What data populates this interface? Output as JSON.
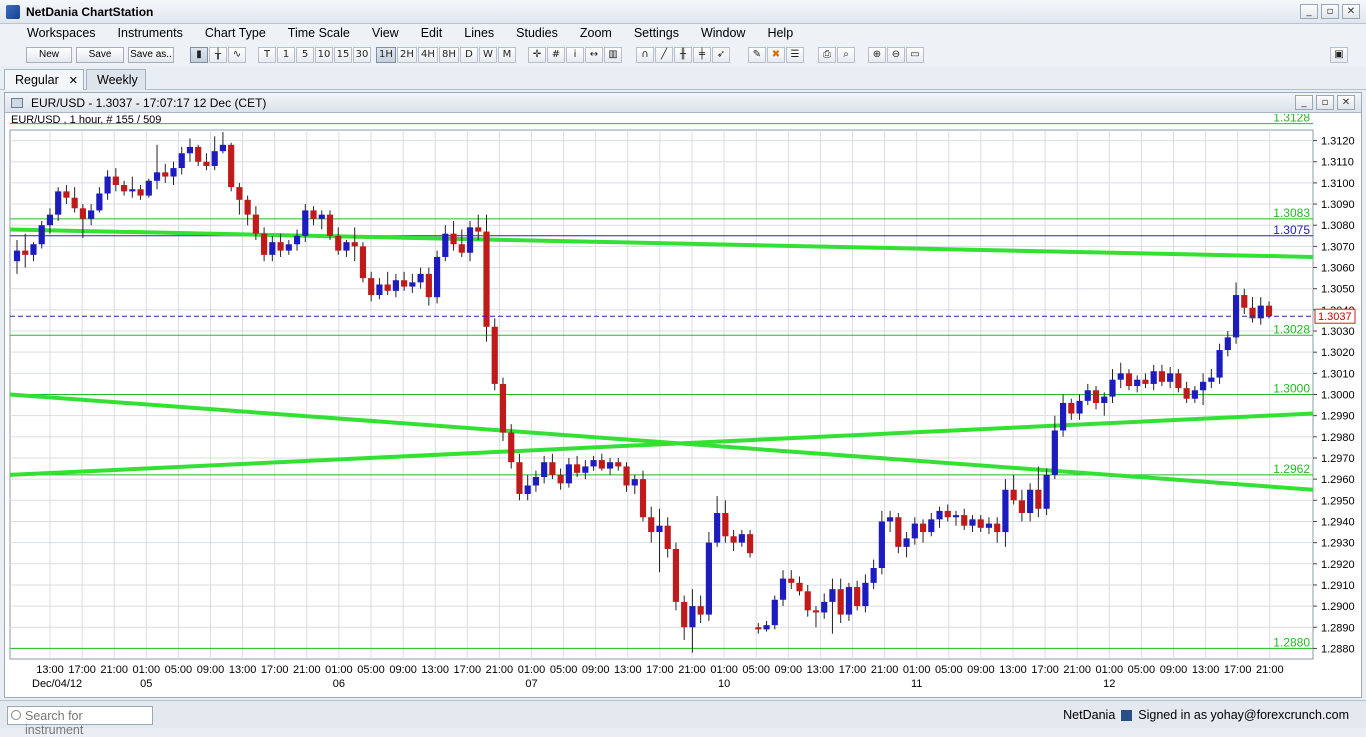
{
  "app": {
    "title": "NetDania ChartStation",
    "controls": {
      "minimize": "_",
      "restore": "▫",
      "close": "✕"
    }
  },
  "menu": [
    "Workspaces",
    "Instruments",
    "Chart Type",
    "Time Scale",
    "View",
    "Edit",
    "Lines",
    "Studies",
    "Zoom",
    "Settings",
    "Window",
    "Help"
  ],
  "toolbar": {
    "new_label": "New",
    "save_label": "Save",
    "save_as_label": "Save as..",
    "periods": [
      "T",
      "1",
      "5",
      "10",
      "15",
      "30",
      "1H",
      "2H",
      "4H",
      "8H",
      "D",
      "W",
      "M"
    ],
    "selected_period": "1H"
  },
  "tabs": [
    {
      "label": "Regular",
      "close": "✕",
      "active": true
    },
    {
      "label": "Weekly",
      "active": false
    }
  ],
  "chart_window": {
    "title": "EUR/USD - 1.3037 - 17:07:17  12 Dec (CET)",
    "subtitle": "EUR/USD , 1 hour, # 155 / 509"
  },
  "chart_data": {
    "type": "candlestick",
    "instrument": "EUR/USD",
    "interval": "1 hour",
    "current_price": "1.3037",
    "ylim": [
      1.2875,
      1.3125
    ],
    "y_ticks": [
      "1.3120",
      "1.3110",
      "1.3100",
      "1.3090",
      "1.3080",
      "1.3070",
      "1.3060",
      "1.3050",
      "1.3040",
      "1.3030",
      "1.3020",
      "1.3010",
      "1.3000",
      "1.2990",
      "1.2980",
      "1.2970",
      "1.2960",
      "1.2950",
      "1.2940",
      "1.2930",
      "1.2920",
      "1.2910",
      "1.2900",
      "1.2890",
      "1.2880"
    ],
    "x_time_labels": [
      "13:00",
      "17:00",
      "21:00",
      "01:00",
      "05:00",
      "09:00",
      "13:00",
      "17:00",
      "21:00",
      "01:00",
      "05:00",
      "09:00",
      "13:00",
      "17:00",
      "21:00",
      "01:00",
      "05:00",
      "09:00",
      "13:00",
      "17:00",
      "21:00",
      "01:00",
      "05:00",
      "09:00",
      "13:00",
      "17:00",
      "21:00",
      "01:00",
      "05:00",
      "09:00",
      "13:00",
      "17:00",
      "21:00",
      "01:00",
      "05:00",
      "09:00",
      "13:00",
      "17:00",
      "21:00"
    ],
    "x_date_labels": [
      {
        "label": "Dec/04/12",
        "index": 0
      },
      {
        "label": "05",
        "index": 3
      },
      {
        "label": "06",
        "index": 9
      },
      {
        "label": "07",
        "index": 15
      },
      {
        "label": "10",
        "index": 21
      },
      {
        "label": "11",
        "index": 27
      },
      {
        "label": "12",
        "index": 33
      }
    ],
    "horizontal_levels": [
      {
        "value": 1.3128,
        "label": "1.3128",
        "color": "#22bb22"
      },
      {
        "value": 1.3083,
        "label": "1.3083",
        "color": "#22bb22"
      },
      {
        "value": 1.3075,
        "label": "1.3075",
        "color": "#2222bb"
      },
      {
        "value": 1.3028,
        "label": "1.3028",
        "color": "#22bb22"
      },
      {
        "value": 1.3,
        "label": "1.3000",
        "color": "#22bb22"
      },
      {
        "value": 1.2962,
        "label": "1.2962",
        "color": "#22bb22"
      },
      {
        "value": 1.288,
        "label": "1.2880",
        "color": "#22bb22"
      }
    ],
    "trend_lines": [
      {
        "from": [
          0,
          1.3078
        ],
        "to": [
          1,
          1.3065
        ]
      },
      {
        "from": [
          0,
          1.3
        ],
        "to": [
          1,
          1.2955
        ]
      },
      {
        "from": [
          0,
          1.2962
        ],
        "to": [
          1,
          1.2991
        ]
      }
    ],
    "candles": [
      [
        1.3063,
        1.3073,
        1.3057,
        1.3068
      ],
      [
        1.3068,
        1.3076,
        1.306,
        1.3066
      ],
      [
        1.3066,
        1.3072,
        1.3063,
        1.3071
      ],
      [
        1.3071,
        1.3082,
        1.3069,
        1.308
      ],
      [
        1.308,
        1.3088,
        1.3076,
        1.3085
      ],
      [
        1.3085,
        1.3098,
        1.3082,
        1.3096
      ],
      [
        1.3096,
        1.3099,
        1.309,
        1.3093
      ],
      [
        1.3093,
        1.3098,
        1.3086,
        1.3088
      ],
      [
        1.3088,
        1.309,
        1.3074,
        1.3083
      ],
      [
        1.3083,
        1.309,
        1.308,
        1.3087
      ],
      [
        1.3087,
        1.3098,
        1.3086,
        1.3095
      ],
      [
        1.3095,
        1.3106,
        1.3092,
        1.3103
      ],
      [
        1.3103,
        1.3107,
        1.3096,
        1.3099
      ],
      [
        1.3099,
        1.3101,
        1.3094,
        1.3096
      ],
      [
        1.3096,
        1.3103,
        1.3093,
        1.3097
      ],
      [
        1.3097,
        1.3099,
        1.3092,
        1.3094
      ],
      [
        1.3094,
        1.3102,
        1.3093,
        1.3101
      ],
      [
        1.3101,
        1.3118,
        1.3097,
        1.3105
      ],
      [
        1.3105,
        1.3109,
        1.31,
        1.3103
      ],
      [
        1.3103,
        1.311,
        1.3099,
        1.3107
      ],
      [
        1.3107,
        1.3117,
        1.3104,
        1.3114
      ],
      [
        1.3114,
        1.3121,
        1.311,
        1.3117
      ],
      [
        1.3117,
        1.3118,
        1.3108,
        1.311
      ],
      [
        1.311,
        1.3114,
        1.3106,
        1.3108
      ],
      [
        1.3108,
        1.3122,
        1.3106,
        1.3115
      ],
      [
        1.3115,
        1.3124,
        1.3114,
        1.3118
      ],
      [
        1.3118,
        1.3119,
        1.3096,
        1.3098
      ],
      [
        1.3098,
        1.31,
        1.3085,
        1.3092
      ],
      [
        1.3092,
        1.3094,
        1.308,
        1.3085
      ],
      [
        1.3085,
        1.3089,
        1.3073,
        1.3076
      ],
      [
        1.3076,
        1.3079,
        1.3063,
        1.3066
      ],
      [
        1.3066,
        1.3075,
        1.3063,
        1.3072
      ],
      [
        1.3072,
        1.3076,
        1.3065,
        1.3068
      ],
      [
        1.3068,
        1.3073,
        1.3066,
        1.3071
      ],
      [
        1.3071,
        1.3078,
        1.3068,
        1.3075
      ],
      [
        1.3075,
        1.309,
        1.3072,
        1.3087
      ],
      [
        1.3087,
        1.3089,
        1.308,
        1.3083
      ],
      [
        1.3083,
        1.3087,
        1.3078,
        1.3085
      ],
      [
        1.3085,
        1.3087,
        1.3073,
        1.3075
      ],
      [
        1.3075,
        1.3079,
        1.3066,
        1.3068
      ],
      [
        1.3068,
        1.3073,
        1.3065,
        1.3072
      ],
      [
        1.3072,
        1.3079,
        1.3063,
        1.307
      ],
      [
        1.307,
        1.3072,
        1.3053,
        1.3055
      ],
      [
        1.3055,
        1.3058,
        1.3044,
        1.3047
      ],
      [
        1.3047,
        1.3055,
        1.3045,
        1.3052
      ],
      [
        1.3052,
        1.3058,
        1.3047,
        1.3049
      ],
      [
        1.3049,
        1.3057,
        1.3046,
        1.3054
      ],
      [
        1.3054,
        1.3058,
        1.3049,
        1.3051
      ],
      [
        1.3051,
        1.3057,
        1.3048,
        1.3053
      ],
      [
        1.3053,
        1.306,
        1.305,
        1.3057
      ],
      [
        1.3057,
        1.306,
        1.3042,
        1.3046
      ],
      [
        1.3046,
        1.3068,
        1.3043,
        1.3065
      ],
      [
        1.3065,
        1.308,
        1.3063,
        1.3076
      ],
      [
        1.3076,
        1.3082,
        1.3068,
        1.3071
      ],
      [
        1.3071,
        1.3078,
        1.3065,
        1.3067
      ],
      [
        1.3067,
        1.3082,
        1.3063,
        1.3079
      ],
      [
        1.3079,
        1.3085,
        1.3073,
        1.3077
      ],
      [
        1.3077,
        1.3085,
        1.3025,
        1.3032
      ],
      [
        1.3032,
        1.3036,
        1.3002,
        1.3005
      ],
      [
        1.3005,
        1.3008,
        1.2978,
        1.2982
      ],
      [
        1.2982,
        1.2986,
        1.2965,
        1.2968
      ],
      [
        1.2968,
        1.2972,
        1.295,
        1.2953
      ],
      [
        1.2953,
        1.2962,
        1.295,
        1.2957
      ],
      [
        1.2957,
        1.2964,
        1.2954,
        1.2961
      ],
      [
        1.2961,
        1.2971,
        1.2958,
        1.2968
      ],
      [
        1.2968,
        1.2972,
        1.296,
        1.2962
      ],
      [
        1.2962,
        1.2965,
        1.2955,
        1.2958
      ],
      [
        1.2958,
        1.297,
        1.2956,
        1.2967
      ],
      [
        1.2967,
        1.2971,
        1.2961,
        1.2963
      ],
      [
        1.2963,
        1.2969,
        1.296,
        1.2966
      ],
      [
        1.2966,
        1.2971,
        1.2964,
        1.2969
      ],
      [
        1.2969,
        1.2972,
        1.2964,
        1.2965
      ],
      [
        1.2965,
        1.297,
        1.2962,
        1.2968
      ],
      [
        1.2968,
        1.297,
        1.2964,
        1.2966
      ],
      [
        1.2966,
        1.2968,
        1.2954,
        1.2957
      ],
      [
        1.2957,
        1.2962,
        1.2953,
        1.296
      ],
      [
        1.296,
        1.2964,
        1.294,
        1.2942
      ],
      [
        1.2942,
        1.2947,
        1.293,
        1.2935
      ],
      [
        1.2935,
        1.2946,
        1.2916,
        1.2938
      ],
      [
        1.2938,
        1.2942,
        1.2923,
        1.2927
      ],
      [
        1.2927,
        1.293,
        1.2898,
        1.2902
      ],
      [
        1.2902,
        1.2905,
        1.2884,
        1.289
      ],
      [
        1.289,
        1.2908,
        1.2878,
        1.29
      ],
      [
        1.29,
        1.2905,
        1.2892,
        1.2896
      ],
      [
        1.2896,
        1.2935,
        1.2893,
        1.293
      ],
      [
        1.293,
        1.2952,
        1.2928,
        1.2944
      ],
      [
        1.2944,
        1.295,
        1.293,
        1.2933
      ],
      [
        1.2933,
        1.2936,
        1.2926,
        1.293
      ],
      [
        1.293,
        1.2936,
        1.2928,
        1.2934
      ],
      [
        1.2934,
        1.2936,
        1.2923,
        1.2925
      ],
      [
        1.289,
        1.2892,
        1.2887,
        1.2889
      ],
      [
        1.2889,
        1.2893,
        1.2888,
        1.2891
      ],
      [
        1.2891,
        1.2905,
        1.2889,
        1.2903
      ],
      [
        1.2903,
        1.2917,
        1.29,
        1.2913
      ],
      [
        1.2913,
        1.2917,
        1.2908,
        1.2911
      ],
      [
        1.2911,
        1.2914,
        1.2905,
        1.2907
      ],
      [
        1.2907,
        1.291,
        1.2895,
        1.2898
      ],
      [
        1.2898,
        1.29,
        1.289,
        1.2897
      ],
      [
        1.2897,
        1.2906,
        1.2894,
        1.2902
      ],
      [
        1.2902,
        1.2913,
        1.2887,
        1.2908
      ],
      [
        1.2908,
        1.2913,
        1.2892,
        1.2896
      ],
      [
        1.2896,
        1.2911,
        1.2893,
        1.2909
      ],
      [
        1.2909,
        1.2912,
        1.2898,
        1.29
      ],
      [
        1.29,
        1.2915,
        1.2897,
        1.2911
      ],
      [
        1.2911,
        1.2922,
        1.2908,
        1.2918
      ],
      [
        1.2918,
        1.2945,
        1.2915,
        1.294
      ],
      [
        1.294,
        1.2945,
        1.2935,
        1.2942
      ],
      [
        1.2942,
        1.2944,
        1.2925,
        1.2928
      ],
      [
        1.2928,
        1.2935,
        1.2923,
        1.2932
      ],
      [
        1.2932,
        1.2942,
        1.2929,
        1.2939
      ],
      [
        1.2939,
        1.2941,
        1.293,
        1.2935
      ],
      [
        1.2935,
        1.2944,
        1.2933,
        1.2941
      ],
      [
        1.2941,
        1.2947,
        1.2937,
        1.2945
      ],
      [
        1.2945,
        1.2948,
        1.294,
        1.2942
      ],
      [
        1.2942,
        1.2945,
        1.2938,
        1.2943
      ],
      [
        1.2943,
        1.2946,
        1.2936,
        1.2938
      ],
      [
        1.2938,
        1.2943,
        1.2935,
        1.2941
      ],
      [
        1.2941,
        1.2943,
        1.2935,
        1.2937
      ],
      [
        1.2937,
        1.2942,
        1.2934,
        1.2939
      ],
      [
        1.2939,
        1.2942,
        1.293,
        1.2935
      ],
      [
        1.2935,
        1.296,
        1.2928,
        1.2955
      ],
      [
        1.2955,
        1.2962,
        1.2948,
        1.295
      ],
      [
        1.295,
        1.2955,
        1.294,
        1.2944
      ],
      [
        1.2944,
        1.2958,
        1.294,
        1.2955
      ],
      [
        1.2955,
        1.2966,
        1.2942,
        1.2946
      ],
      [
        1.2946,
        1.2965,
        1.2943,
        1.2962
      ],
      [
        1.2962,
        1.299,
        1.296,
        1.2983
      ],
      [
        1.2983,
        1.3,
        1.298,
        1.2996
      ],
      [
        1.2996,
        1.2998,
        1.2988,
        1.2991
      ],
      [
        1.2991,
        1.3,
        1.2988,
        1.2997
      ],
      [
        1.2997,
        1.3005,
        1.2995,
        1.3002
      ],
      [
        1.3002,
        1.3004,
        1.2993,
        1.2996
      ],
      [
        1.2996,
        1.3001,
        1.299,
        1.2999
      ],
      [
        1.2999,
        1.3012,
        1.2996,
        1.3007
      ],
      [
        1.3007,
        1.3015,
        1.3003,
        1.301
      ],
      [
        1.301,
        1.3012,
        1.3002,
        1.3004
      ],
      [
        1.3004,
        1.3009,
        1.3001,
        1.3007
      ],
      [
        1.3007,
        1.301,
        1.3003,
        1.3005
      ],
      [
        1.3005,
        1.3014,
        1.3002,
        1.3011
      ],
      [
        1.3011,
        1.3014,
        1.3004,
        1.3006
      ],
      [
        1.3006,
        1.3013,
        1.3003,
        1.301
      ],
      [
        1.301,
        1.3012,
        1.3001,
        1.3003
      ],
      [
        1.3003,
        1.3006,
        1.2996,
        1.2998
      ],
      [
        1.2998,
        1.3004,
        1.2996,
        1.3002
      ],
      [
        1.3002,
        1.301,
        1.2995,
        1.3006
      ],
      [
        1.3006,
        1.3012,
        1.3003,
        1.3008
      ],
      [
        1.3008,
        1.3024,
        1.3005,
        1.3021
      ],
      [
        1.3021,
        1.303,
        1.3018,
        1.3027
      ],
      [
        1.3027,
        1.3053,
        1.3024,
        1.3047
      ],
      [
        1.3047,
        1.305,
        1.3038,
        1.3041
      ],
      [
        1.3041,
        1.3046,
        1.3034,
        1.3036
      ],
      [
        1.3036,
        1.3046,
        1.3033,
        1.3042
      ],
      [
        1.3042,
        1.3044,
        1.3036,
        1.3037
      ]
    ]
  },
  "status": {
    "search_placeholder": "Search for instrument",
    "brand": "NetDania",
    "signed_in": "Signed in as yohay@forexcrunch.com"
  }
}
